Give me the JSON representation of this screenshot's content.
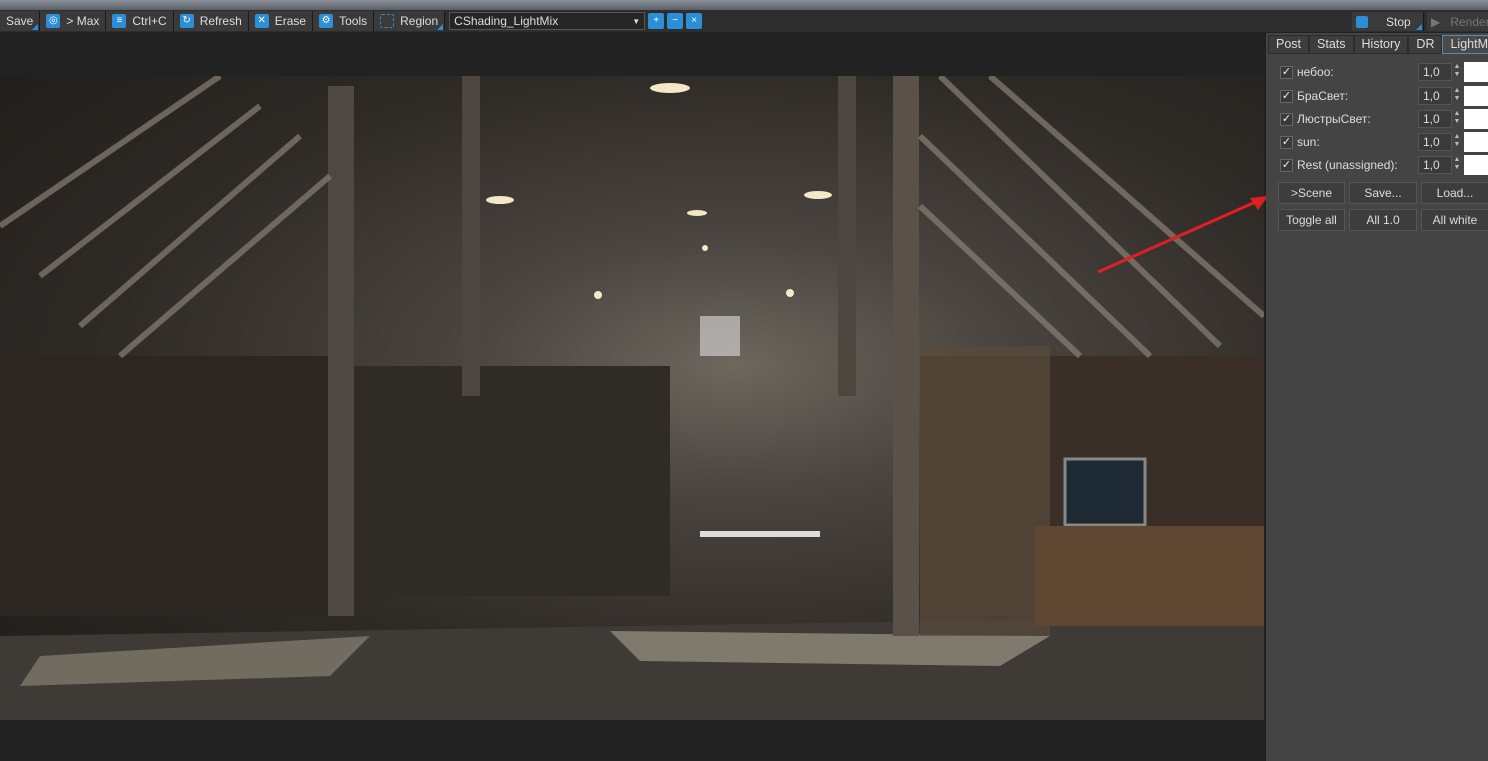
{
  "toolbar": {
    "save": "Save",
    "max": "> Max",
    "copy": "Ctrl+C",
    "refresh": "Refresh",
    "erase": "Erase",
    "tools": "Tools",
    "region": "Region",
    "channel": "CShading_LightMix",
    "stop": "Stop",
    "render": "Render"
  },
  "panel": {
    "tabs": [
      "Post",
      "Stats",
      "History",
      "DR",
      "LightMix"
    ],
    "active_tab": "LightMix",
    "lights": [
      {
        "label": "небоо:",
        "checked": true,
        "value": "1,0",
        "color": "#ffffff"
      },
      {
        "label": "БраСвет:",
        "checked": true,
        "value": "1,0",
        "color": "#ffffff"
      },
      {
        "label": "ЛюстрыСвет:",
        "checked": true,
        "value": "1,0",
        "color": "#ffffff"
      },
      {
        "label": "sun:",
        "checked": true,
        "value": "1,0",
        "color": "#ffffff"
      },
      {
        "label": "Rest (unassigned):",
        "checked": true,
        "value": "1,0",
        "color": "#ffffff"
      }
    ],
    "buttons": {
      "scene": ">Scene",
      "save": "Save...",
      "load": "Load...",
      "toggle_all": "Toggle all",
      "all_one": "All 1.0",
      "all_white": "All white"
    }
  },
  "colors": {
    "accent": "#2a8fd6",
    "arrow": "#e02020"
  }
}
